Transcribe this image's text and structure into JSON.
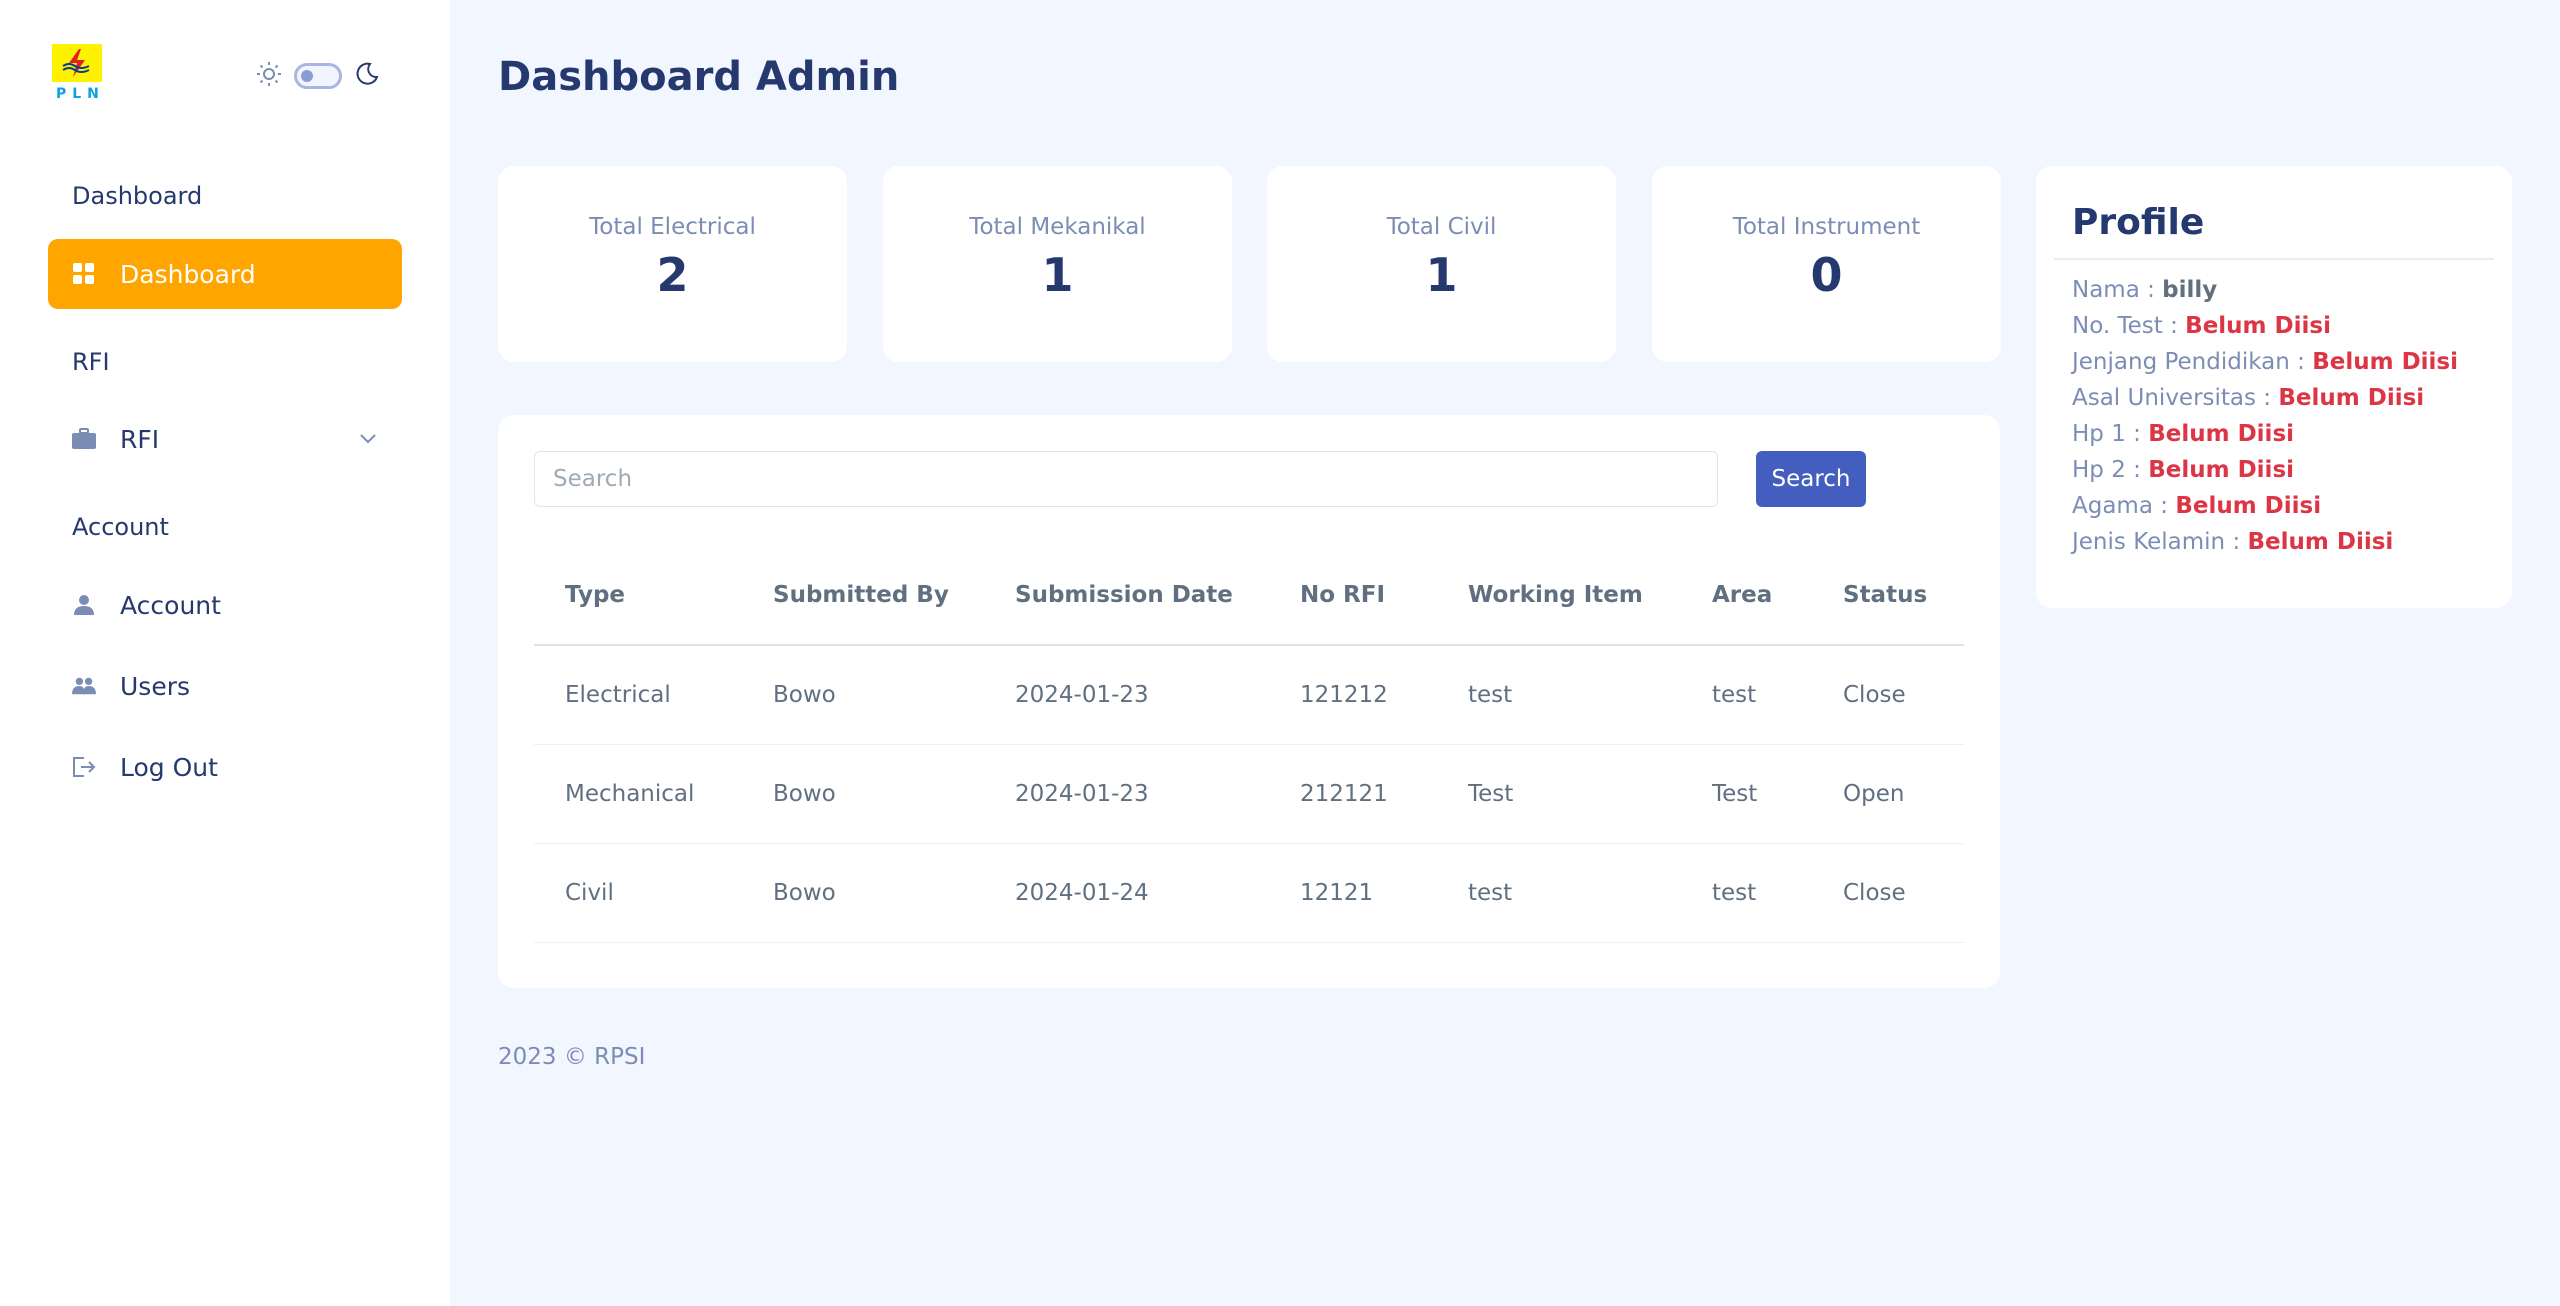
{
  "brand": {
    "logo_text": "PLN",
    "accent": "#ffa500",
    "primary": "#435ebe"
  },
  "theme_toggle": {
    "sun_icon": "sun-icon",
    "moon_icon": "moon-icon"
  },
  "sidebar": {
    "sections": [
      {
        "title": "Dashboard"
      },
      {
        "title": "RFI"
      },
      {
        "title": "Account"
      }
    ],
    "items": [
      {
        "label": "Dashboard",
        "icon": "grid-icon"
      },
      {
        "label": "RFI",
        "icon": "briefcase-icon"
      },
      {
        "label": "Account",
        "icon": "person-icon"
      },
      {
        "label": "Users",
        "icon": "people-icon"
      },
      {
        "label": "Log Out",
        "icon": "logout-icon"
      }
    ]
  },
  "main": {
    "title": "Dashboard Admin",
    "stats": [
      {
        "label": "Total Electrical",
        "value": "2"
      },
      {
        "label": "Total Mekanikal",
        "value": "1"
      },
      {
        "label": "Total Civil",
        "value": "1"
      },
      {
        "label": "Total Instrument",
        "value": "0"
      }
    ],
    "search": {
      "placeholder": "Search",
      "button_label": "Search"
    },
    "table": {
      "headers": [
        "Type",
        "Submitted By",
        "Submission Date",
        "No RFI",
        "Working Item",
        "Area",
        "Status"
      ],
      "rows": [
        [
          "Electrical",
          "Bowo",
          "2024-01-23",
          "121212",
          "test",
          "test",
          "Close"
        ],
        [
          "Mechanical",
          "Bowo",
          "2024-01-23",
          "212121",
          "Test",
          "Test",
          "Open"
        ],
        [
          "Civil",
          "Bowo",
          "2024-01-24",
          "12121",
          "test",
          "test",
          "Close"
        ]
      ]
    }
  },
  "profile": {
    "title": "Profile",
    "fields": [
      {
        "label": "Nama : ",
        "value": "billy"
      },
      {
        "label": "No. Test : ",
        "value": "Belum Diisi"
      },
      {
        "label": "Jenjang Pendidikan : ",
        "value": "Belum Diisi"
      },
      {
        "label": "Asal Universitas : ",
        "value": "Belum Diisi"
      },
      {
        "label": "Hp 1 : ",
        "value": "Belum Diisi"
      },
      {
        "label": "Hp 2 : ",
        "value": "Belum Diisi"
      },
      {
        "label": "Agama : ",
        "value": "Belum Diisi"
      },
      {
        "label": "Jenis Kelamin : ",
        "value": "Belum Diisi"
      }
    ]
  },
  "footer": {
    "text": "2023 © RPSI"
  }
}
